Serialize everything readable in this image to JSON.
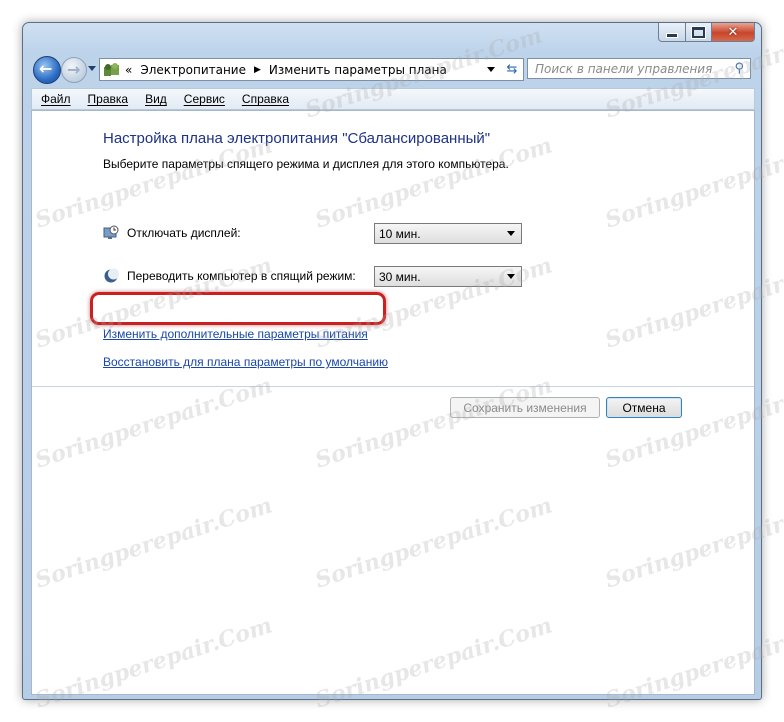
{
  "window": {
    "caption_buttons": {
      "minimize": "–",
      "maximize": "□",
      "close": "✕"
    }
  },
  "nav": {
    "back_icon": "back-arrow-icon",
    "forward_icon": "forward-arrow-icon",
    "breadcrumb": [
      "«",
      "Электропитание",
      "Изменить параметры плана"
    ],
    "search_placeholder": "Поиск в панели управления"
  },
  "menu": [
    "Файл",
    "Правка",
    "Вид",
    "Сервис",
    "Справка"
  ],
  "content": {
    "title": "Настройка плана электропитания \"Сбалансированный\"",
    "subtitle": "Выберите параметры спящего режима и дисплея для этого компьютера.",
    "display_label": "Отключать дисплей:",
    "display_value": "10 мин.",
    "sleep_label": "Переводить компьютер в спящий режим:",
    "sleep_value": "30 мин.",
    "advanced_link": "Изменить дополнительные параметры питания",
    "restore_link": "Восстановить для плана параметры по умолчанию",
    "save_button": "Сохранить изменения",
    "cancel_button": "Отмена"
  },
  "watermark": "Soringperepair.Com",
  "colors": {
    "highlight": "#cc1f1f",
    "title": "#1e3287",
    "link": "#1a47a8"
  }
}
